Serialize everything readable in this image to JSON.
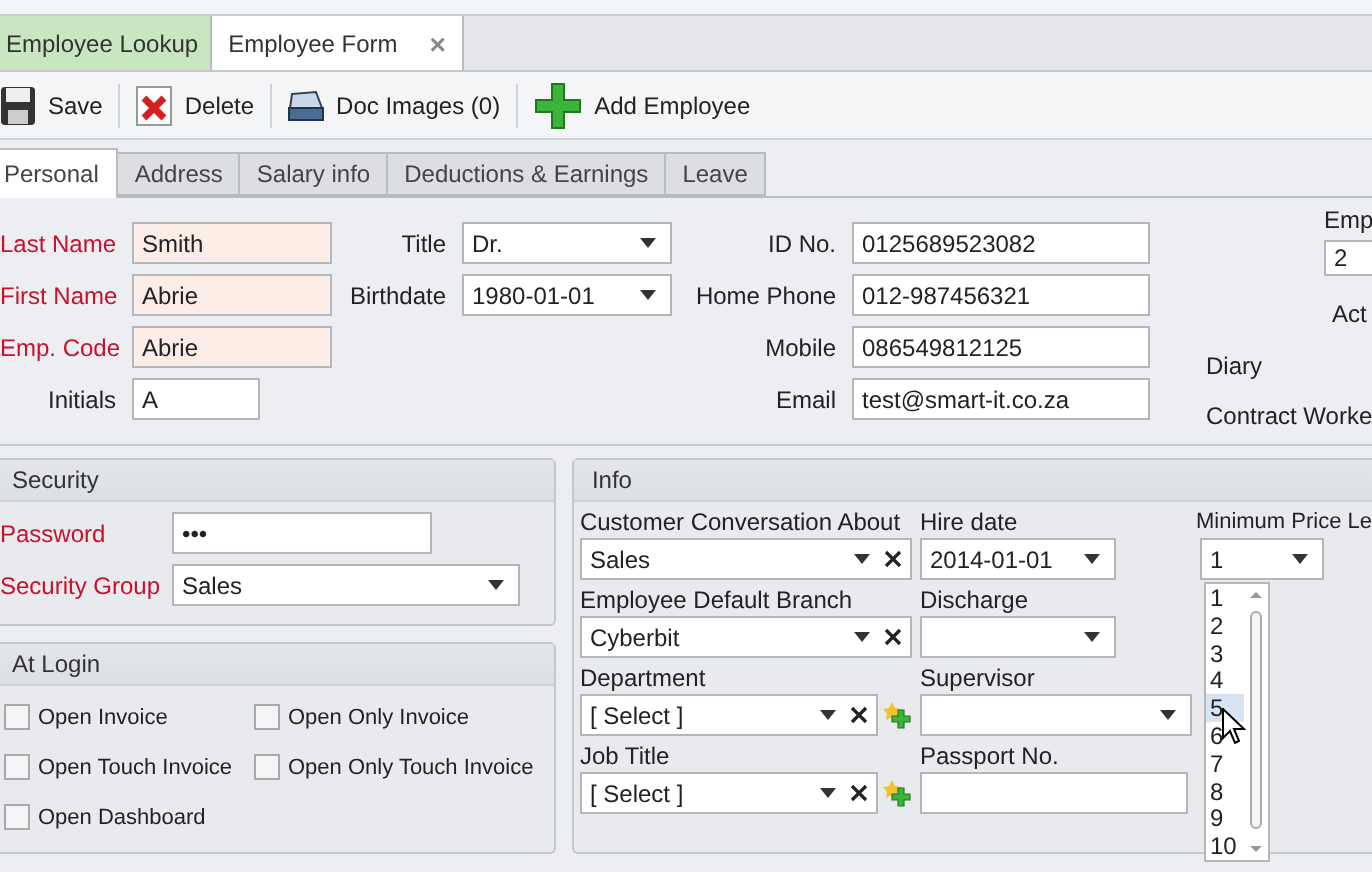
{
  "doc_tabs": [
    {
      "label": "Employee Lookup",
      "selected": false
    },
    {
      "label": "Employee Form",
      "selected": true,
      "close": "×"
    }
  ],
  "toolbar": [
    {
      "kind": "save",
      "label": "Save"
    },
    {
      "kind": "delete",
      "label": "Delete"
    },
    {
      "kind": "scan",
      "label": "Doc Images (0)"
    },
    {
      "kind": "add",
      "label": "Add Employee"
    }
  ],
  "tabs": [
    {
      "label": "Personal",
      "selected": true
    },
    {
      "label": "Address",
      "selected": false
    },
    {
      "label": "Salary info",
      "selected": false
    },
    {
      "label": "Deductions & Earnings",
      "selected": false
    },
    {
      "label": "Leave",
      "selected": false
    }
  ],
  "personal": {
    "columns": [
      [
        {
          "label": "Last Name",
          "value": "Smith",
          "required": true,
          "kind": "text"
        },
        {
          "label": "First Name",
          "value": "Abrie",
          "required": true,
          "kind": "text"
        },
        {
          "label": "Emp. Code",
          "value": "Abrie",
          "required": true,
          "kind": "text"
        },
        {
          "label": "Initials",
          "value": "A",
          "required": false,
          "kind": "text"
        }
      ],
      [
        {
          "label": "Title",
          "value": "Dr.",
          "required": false,
          "kind": "select"
        },
        {
          "label": "Birthdate",
          "value": "1980-01-01",
          "required": false,
          "kind": "select"
        }
      ],
      [
        {
          "label": "ID No.",
          "value": "0125689523082",
          "required": false,
          "kind": "text"
        },
        {
          "label": "Home Phone",
          "value": "012-987456321",
          "required": false,
          "kind": "text"
        },
        {
          "label": "Mobile",
          "value": "086549812125",
          "required": false,
          "kind": "text"
        },
        {
          "label": "Email",
          "value": "test@smart-it.co.za",
          "required": false,
          "kind": "text"
        }
      ]
    ],
    "side": {
      "emp_label": "Emp",
      "emp_value": "2",
      "labels": [
        "Act",
        "Diary",
        "Contract Worke"
      ]
    }
  },
  "security": {
    "title": "Security",
    "fields": [
      {
        "label": "Password",
        "value": "•••",
        "required": true,
        "kind": "text"
      },
      {
        "label": "Security Group",
        "value": "Sales",
        "required": true,
        "kind": "select"
      }
    ]
  },
  "at_login": {
    "title": "At Login",
    "options": [
      {
        "label": "Open Invoice",
        "checked": false
      },
      {
        "label": "Open Only Invoice",
        "checked": false
      },
      {
        "label": "Open Touch Invoice",
        "checked": false
      },
      {
        "label": "Open Only Touch Invoice",
        "checked": false
      },
      {
        "label": "Open Dashboard",
        "checked": false
      }
    ]
  },
  "info": {
    "title": "Info",
    "columns": [
      [
        {
          "label": "Customer Conversation About",
          "value": "Sales",
          "kind": "select",
          "clear": true
        },
        {
          "label": "Employee Default Branch",
          "value": "Cyberbit",
          "kind": "select",
          "clear": true
        },
        {
          "label": "Department",
          "value": "[ Select ]",
          "kind": "select",
          "clear": true,
          "add": true
        },
        {
          "label": "Job Title",
          "value": "[ Select ]",
          "kind": "select",
          "clear": true,
          "add": true
        }
      ],
      [
        {
          "label": "Hire date",
          "value": "2014-01-01",
          "kind": "select"
        },
        {
          "label": "Discharge",
          "kind": "select"
        },
        {
          "label": "Supervisor",
          "kind": "select"
        },
        {
          "label": "Passport No.",
          "kind": "text"
        }
      ],
      [
        {
          "label": "Minimum Price Le",
          "value": "1",
          "kind": "select"
        }
      ]
    ],
    "price_list": [
      {
        "label": "1",
        "selected": false
      },
      {
        "label": "2",
        "selected": false
      },
      {
        "label": "3",
        "selected": false
      },
      {
        "label": "4",
        "selected": false
      },
      {
        "label": "5",
        "selected": true
      },
      {
        "label": "6",
        "selected": false
      },
      {
        "label": "7",
        "selected": false
      },
      {
        "label": "8",
        "selected": false
      },
      {
        "label": "9",
        "selected": false
      },
      {
        "label": "10",
        "selected": false
      }
    ]
  }
}
